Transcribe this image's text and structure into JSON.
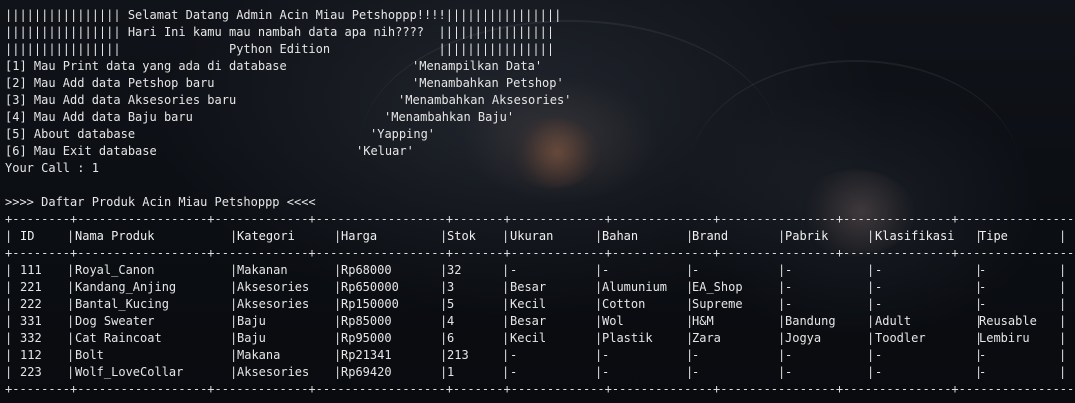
{
  "banner": [
    "|||||||||||||||| Selamat Datang Admin Acin Miau Petshoppp!!!!||||||||||||||||",
    "|||||||||||||||| Hari Ini kamu mau nambah data apa nih????  ||||||||||||||||",
    "||||||||||||||||               Python Edition               ||||||||||||||||"
  ],
  "menu": [
    {
      "label": "[1] Mau Print data yang ada di database",
      "desc": "'Menampilkan Data'"
    },
    {
      "label": "[2] Mau Add data Petshop baru",
      "desc": "'Menambahkan Petshop'"
    },
    {
      "label": "[3] Mau Add data Aksesories baru",
      "desc": "'Menambahkan Aksesories'"
    },
    {
      "label": "[4] Mau Add data Baju baru",
      "desc": "'Menambahkan Baju'"
    },
    {
      "label": "[5] About database",
      "desc": "'Yapping'"
    },
    {
      "label": "[6] Mau Exit database",
      "desc": "'Keluar'"
    }
  ],
  "prompt": "Your Call : 1",
  "list_title": ">>>> Daftar Produk Acin Miau Petshoppp <<<<",
  "table": {
    "separator": "+--------+------------------+-------------+------------------+-------+-------------+--------------+----------------+---------------+-----------------+-------------+",
    "headers": [
      "ID",
      "Nama Produk",
      "Kategori",
      "Harga",
      "Stok",
      "Ukuran",
      "Bahan",
      "Brand",
      "Pabrik",
      "Klasifikasi",
      "Tipe"
    ],
    "rows": [
      [
        "111",
        "Royal_Canon",
        "Makanan",
        "Rp68000",
        "32",
        "-",
        "-",
        "-",
        "-",
        "-",
        "-"
      ],
      [
        "221",
        "Kandang_Anjing",
        "Aksesories",
        "Rp650000",
        "3",
        "Besar",
        "Alumunium",
        "EA_Shop",
        "-",
        "-",
        "-"
      ],
      [
        "222",
        "Bantal_Kucing",
        "Aksesories",
        "Rp150000",
        "5",
        "Kecil",
        "Cotton",
        "Supreme",
        "-",
        "-",
        "-"
      ],
      [
        "331",
        "Dog Sweater",
        "Baju",
        "Rp85000",
        "4",
        "Besar",
        "Wol",
        "H&M",
        "Bandung",
        "Adult",
        "Reusable"
      ],
      [
        "332",
        "Cat Raincoat",
        "Baju",
        "Rp95000",
        "6",
        "Kecil",
        "Plastik",
        "Zara",
        "Jogya",
        "Toodler",
        "Lembiru"
      ],
      [
        "112",
        "Bolt",
        "Makana",
        "Rp21341",
        "213",
        "-",
        "-",
        "-",
        "-",
        "-",
        "-"
      ],
      [
        "223",
        "Wolf_LoveCollar",
        "Aksesories",
        "Rp69420",
        "1",
        "-",
        "-",
        "-",
        "-",
        "-",
        "-"
      ]
    ]
  },
  "colors": {
    "background": "#0c0f14",
    "text": "#e6e6e6"
  }
}
